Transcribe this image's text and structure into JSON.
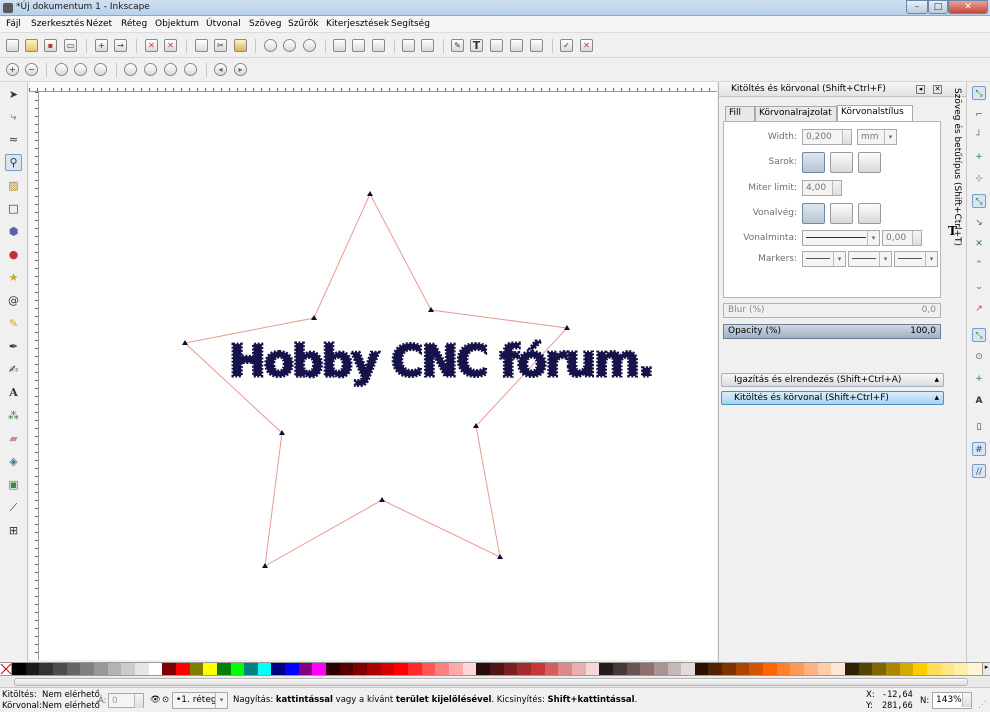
{
  "window": {
    "title": "*Új dokumentum 1 - Inkscape"
  },
  "menu": [
    "Fájl",
    "Szerkesztés",
    "Nézet",
    "Réteg",
    "Objektum",
    "Útvonal",
    "Szöveg",
    "Szűrők",
    "Kiterjesztések",
    "Segítség"
  ],
  "canvas": {
    "text": "Hobby CNC fórum.",
    "text_color": "#16124a",
    "star_color": "#e89a94",
    "node_color": "#0d0d3a"
  },
  "panel": {
    "title": "Kitöltés és körvonal (Shift+Ctrl+F)",
    "tabs": [
      "Fill",
      "Körvonalrajzolat",
      "Körvonalstílus"
    ],
    "width_label": "Width:",
    "width_value": "0,200",
    "unit": "mm",
    "corner_label": "Sarok:",
    "miter_label": "Miter limit:",
    "miter_value": "4,00",
    "cap_label": "Vonalvég:",
    "dash_label": "Vonalminta:",
    "dash_offset": "0,00",
    "markers_label": "Markers:",
    "blur_label": "Blur (%)",
    "blur_value": "0,0",
    "opacity_label": "Opacity (%)",
    "opacity_value": "100,0",
    "opacity": 1.0,
    "docks": [
      "Igazítás és elrendezés (Shift+Ctrl+A)",
      "Kitöltés és körvonal (Shift+Ctrl+F)"
    ],
    "side_tab": "Szöveg és betűtípus (Shift+Ctrl+T)",
    "accent": "#a9d3f0"
  },
  "palette": [
    "#000000",
    "#1a1a1a",
    "#333333",
    "#4d4d4d",
    "#666666",
    "#808080",
    "#999999",
    "#b3b3b3",
    "#cccccc",
    "#e6e6e6",
    "#ffffff",
    "#800000",
    "#ff0000",
    "#808000",
    "#ffff00",
    "#008000",
    "#00ff00",
    "#008080",
    "#00ffff",
    "#000080",
    "#0000ff",
    "#800080",
    "#ff00ff",
    "#2b0000",
    "#550000",
    "#800000",
    "#aa0000",
    "#d40000",
    "#ff0000",
    "#ff2a2a",
    "#ff5555",
    "#ff8080",
    "#ffaaaa",
    "#ffd5d5",
    "#280b0b",
    "#501616",
    "#782121",
    "#a02c2c",
    "#c83737",
    "#d35f5f",
    "#de8787",
    "#e9afaf",
    "#f4d7d7",
    "#241c1c",
    "#483737",
    "#6c5353",
    "#916f6f",
    "#ac9393",
    "#c8b7b7",
    "#e3dbdb",
    "#2b1100",
    "#552200",
    "#803300",
    "#aa4400",
    "#d45500",
    "#ff6600",
    "#ff7f2a",
    "#ff9955",
    "#ffb380",
    "#ffccaa",
    "#ffe6d5",
    "#2b2200",
    "#554400",
    "#806600",
    "#aa8800",
    "#d4aa00",
    "#ffcc00",
    "#ffdd55",
    "#ffe680",
    "#ffeeaa",
    "#fff6d5"
  ],
  "status": {
    "fill_label": "Kitöltés:",
    "fill_value": "Nem elérhető",
    "stroke_label": "Körvonal:",
    "stroke_value": "Nem elérhető",
    "opacity_label": "Á:",
    "opacity_value": "0",
    "layer": "•1. réteg",
    "message_plain1": "Nagyítás:",
    "message_bold1": "kattintással",
    "message_plain2": "vagy a kívánt",
    "message_bold2": "terület kijelölésével",
    "message_plain3": ". Kicsinyítés:",
    "message_bold3": "Shift+kattintással",
    "message_end": ".",
    "x_label": "X:",
    "x_value": "-12,64",
    "y_label": "Y:",
    "y_value": "281,66",
    "zoom_label": "N:",
    "zoom_value": "143%"
  }
}
